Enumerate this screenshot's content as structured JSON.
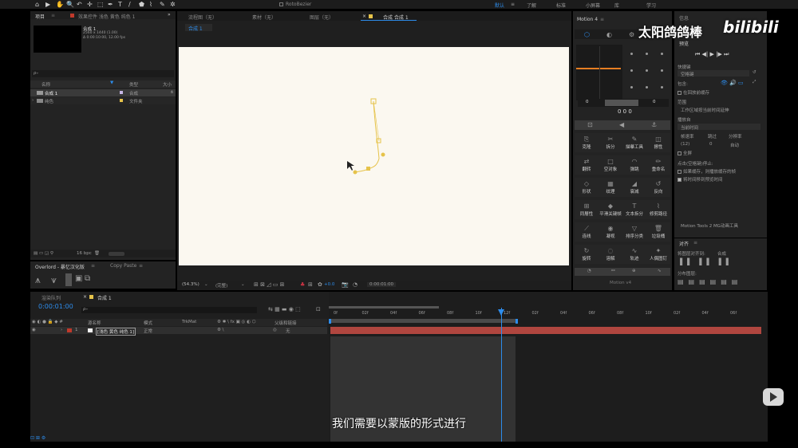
{
  "toolbar": {
    "tools": [
      "⌂",
      "▶",
      "✋",
      "🔍",
      "↶",
      "✛",
      "⬚",
      "✒",
      "T",
      "/",
      "⬟",
      "⌇",
      "✎",
      "✲"
    ],
    "roto_label": "RotoBezier",
    "workspaces": [
      "默认",
      "≡",
      "了解",
      "标准",
      "小屏幕",
      "库",
      "学习"
    ]
  },
  "project_panel": {
    "tab_label": "项目",
    "effects_tab": "效果控件 浅色 黄色 纯色 1",
    "comp_name": "合成 1",
    "comp_info_1": "2560 x 1440 (1.00)",
    "comp_info_2": "Δ 0:00:10:00, 12.00 fps",
    "search_placeholder": "ρ₊",
    "col_name": "名称",
    "col_type": "类型",
    "col_size": "大小",
    "items": [
      {
        "name": "合成 1",
        "type": "合成",
        "color": "#c7b7e6"
      },
      {
        "name": "纯色",
        "type": "文件夹",
        "color": "#e6c34a"
      }
    ],
    "bpc": "16 bpc"
  },
  "overlord": {
    "tab_label": "Overlord - 暴忆汉化版",
    "copy_paste_tab": "Copy Paste"
  },
  "viewer": {
    "tabs": [
      "流程图（无）",
      "素材（无）",
      "图层（无）",
      "合成 合成 1"
    ],
    "sub_tab": "合成 1",
    "zoom": "(54.3%)",
    "quality": "(完整)",
    "exposure": "+0.0",
    "timecode": "0:00:01:00"
  },
  "motion": {
    "title": "Motion 4",
    "slider_left": "0",
    "slider_right": "0",
    "readout": "0 0 0",
    "version": "Motion v4",
    "buttons": [
      {
        "label": "克隆",
        "icon": "⎘"
      },
      {
        "label": "拆分",
        "icon": "✂"
      },
      {
        "label": "描摹工具",
        "icon": "✎"
      },
      {
        "label": "擦性",
        "icon": "◫"
      },
      {
        "label": "翻转",
        "icon": "⇄"
      },
      {
        "label": "空对象",
        "icon": "□"
      },
      {
        "label": "弹跳",
        "icon": "◠"
      },
      {
        "label": "重命名",
        "icon": "✏"
      },
      {
        "label": "形状",
        "icon": "◇"
      },
      {
        "label": "纹理",
        "icon": "▦"
      },
      {
        "label": "衰减",
        "icon": "◢"
      },
      {
        "label": "反向",
        "icon": "↺"
      },
      {
        "label": "同層性",
        "icon": "⊞"
      },
      {
        "label": "平滑关键帧",
        "icon": "◆"
      },
      {
        "label": "文本拆分",
        "icon": "T"
      },
      {
        "label": "修剪路径",
        "icon": "⌇"
      },
      {
        "label": "连线",
        "icon": "⟋"
      },
      {
        "label": "凝视",
        "icon": "◉"
      },
      {
        "label": "排序分类",
        "icon": "▽"
      },
      {
        "label": "垃圾桶",
        "icon": "🗑"
      },
      {
        "label": "旋转",
        "icon": "↻"
      },
      {
        "label": "溶解",
        "icon": "◌"
      },
      {
        "label": "轨迹",
        "icon": "∿"
      },
      {
        "label": "人偶图钉",
        "icon": "✦"
      }
    ]
  },
  "info_panel": {
    "tab_info": "信息",
    "tab_preview": "预览",
    "shortcut_label": "快捷键",
    "shortcut_value": "空格键",
    "include_label": "包含:",
    "cache_label": "在回放前缓存",
    "range_label": "范围",
    "range_value": "工作区域按当前时间延伸",
    "play_from_label": "播放自",
    "play_from_value": "当前时间",
    "framerate_label": "帧速率",
    "skip_label": "跳过",
    "resolution_label": "分辨率",
    "framerate_value": "(12)",
    "skip_value": "0",
    "resolution_value": "自动",
    "fullscreen_label": "全屏",
    "stop_label": "点击(空格键)停止:",
    "option1": "如果缓存，则播放缓存的帧",
    "option2": "将时间移到预览时间",
    "mg_tools": "Motion Tools 2 MG动画工具"
  },
  "align_panel": {
    "tab_label": "对齐",
    "align_to_label": "将图层对齐到:",
    "align_to_value": "合成",
    "distribute_label": "分布图层:"
  },
  "timeline": {
    "render_tab": "渲染队列",
    "comp_tab": "合成 1",
    "timecode": "0:00:01:00",
    "search_placeholder": "ρ₊",
    "headers": {
      "source": "源名称",
      "mode": "模式",
      "trkmat": "TrkMat",
      "parent": "父级和链接"
    },
    "layer": {
      "num": "1",
      "name": "[浅色 黄色 纯色 1]",
      "mode": "正常",
      "parent": "无"
    },
    "ruler_ticks": [
      "0f",
      "02f",
      "04f",
      "06f",
      "08f",
      "10f",
      "12f",
      "02f",
      "04f",
      "06f",
      "08f",
      "10f",
      "02f",
      "04f",
      "06f"
    ]
  },
  "subtitle": "我们需要以蒙版的形式进行",
  "watermark": {
    "author": "太阳鸽鸽棒",
    "logo": "bilibili"
  },
  "colors": {
    "accent": "#2d8ceb",
    "layer_bar": "#b0463f",
    "keyframe": "#e6c34a"
  }
}
